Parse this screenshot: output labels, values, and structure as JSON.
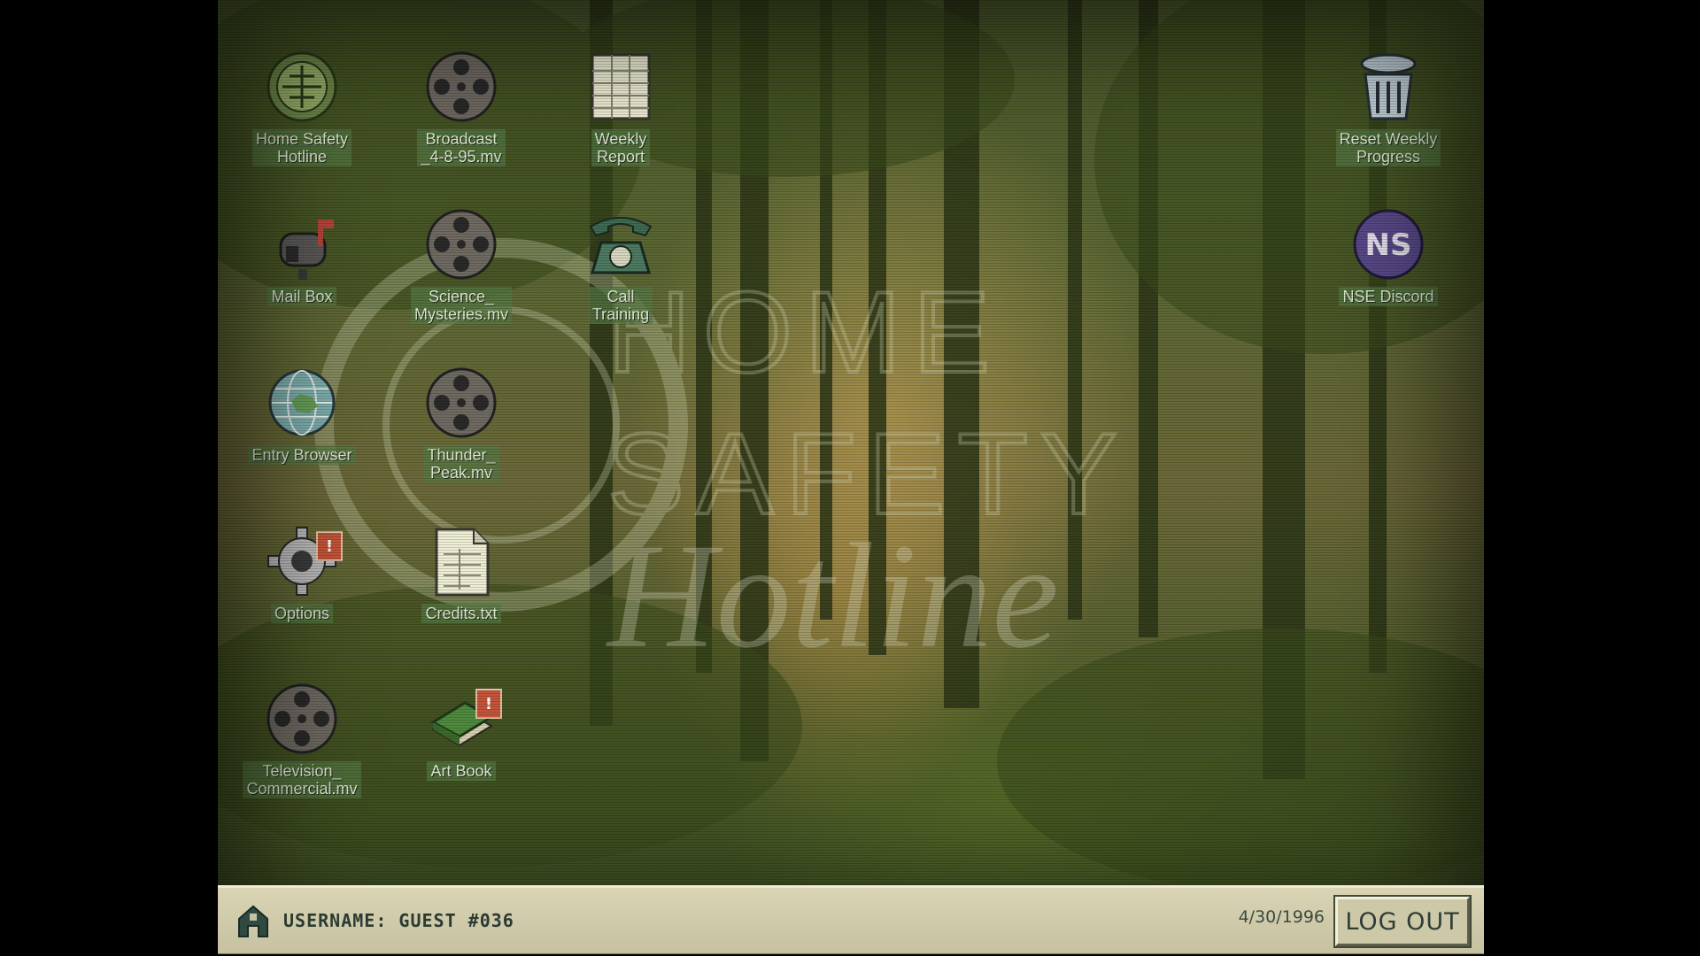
{
  "desktop": {
    "icons": [
      {
        "label": "Home Safety\nHotline"
      },
      {
        "label": "Broadcast\n_4-8-95.mv"
      },
      {
        "label": "Weekly\nReport"
      },
      {
        "label": "Reset Weekly\nProgress"
      },
      {
        "label": "Mail Box"
      },
      {
        "label": "Science_\nMysteries.mv"
      },
      {
        "label": "Call\nTraining"
      },
      {
        "label": "NSE Discord"
      },
      {
        "label": "Entry Browser"
      },
      {
        "label": "Thunder_\nPeak.mv"
      },
      {
        "label": "Options",
        "badge": "!"
      },
      {
        "label": "Credits.txt"
      },
      {
        "label": "Television_\nCommercial.mv"
      },
      {
        "label": "Art Book",
        "badge": "!"
      }
    ],
    "nse_text": "NS",
    "watermark": {
      "line1": "HOME",
      "line2": "SAFETY",
      "line3": "Hotline"
    }
  },
  "taskbar": {
    "username": "USERNAME: GUEST #036",
    "date": "4/30/1996",
    "logout_label": "LOG OUT"
  },
  "colors": {
    "label_bg": "#567a46",
    "taskbar_bg": "#d9d4b4",
    "badge": "#c4553a"
  }
}
